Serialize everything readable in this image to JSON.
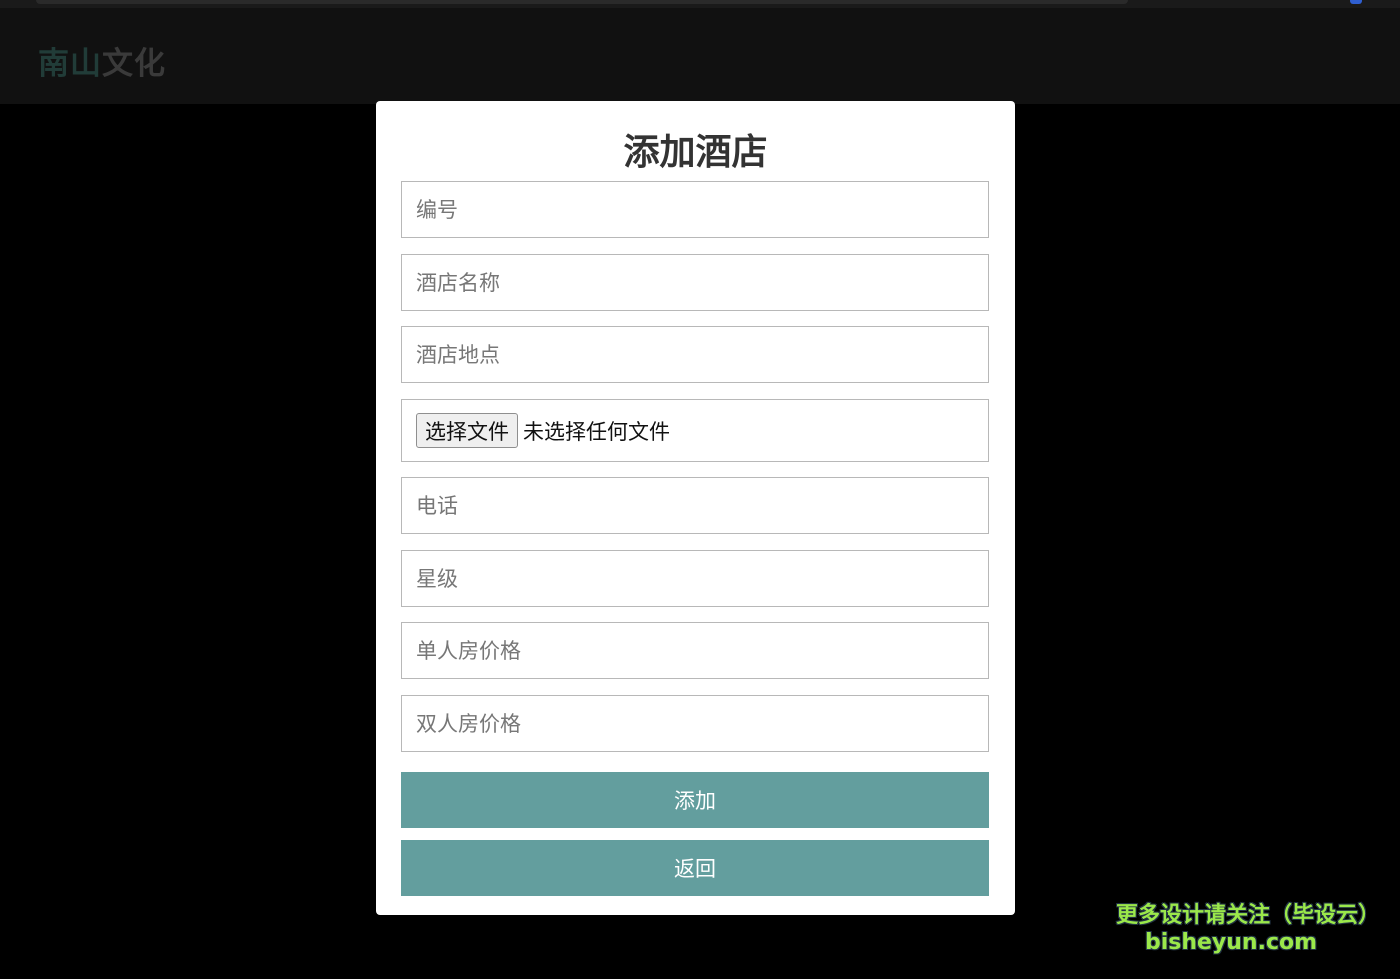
{
  "header": {
    "logo_part1": "南山",
    "logo_part2": "文化"
  },
  "modal": {
    "title": "添加酒店",
    "fields": {
      "number_placeholder": "编号",
      "name_placeholder": "酒店名称",
      "location_placeholder": "酒店地点",
      "phone_placeholder": "电话",
      "star_placeholder": "星级",
      "single_price_placeholder": "单人房价格",
      "double_price_placeholder": "双人房价格"
    },
    "file": {
      "button_label": "选择文件",
      "status": "未选择任何文件"
    },
    "submit_label": "添加",
    "back_label": "返回"
  },
  "watermark": {
    "line1": "更多设计请关注（毕设云）",
    "line2": "bisheyun.com"
  },
  "colors": {
    "accent": "#639e9e",
    "logo_green": "#213c38",
    "watermark": "#9be84a"
  }
}
